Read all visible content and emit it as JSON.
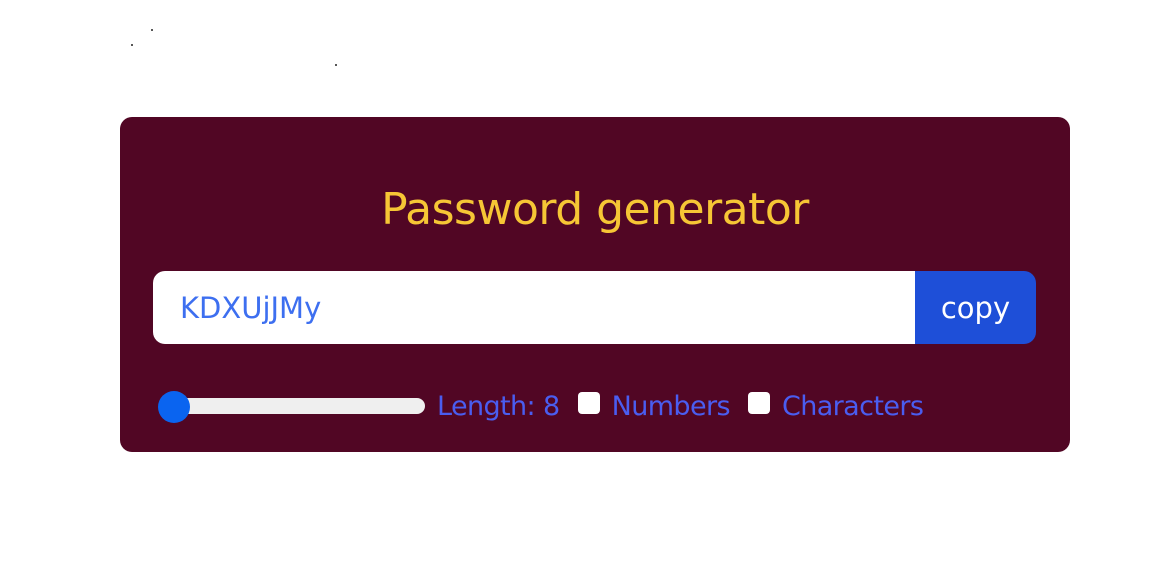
{
  "app": {
    "title": "Password generator"
  },
  "password": {
    "value": "KDXUjJMy",
    "copy_label": "copy"
  },
  "controls": {
    "length_label": "Length: 8",
    "length_value": 8,
    "numbers_label": "Numbers",
    "numbers_checked": false,
    "characters_label": "Characters",
    "characters_checked": false
  },
  "colors": {
    "card_background": "#510624",
    "title": "#f6c635",
    "accent": "#1e4fd8",
    "label_text": "#4a5df0",
    "slider_thumb": "#0a64f0"
  },
  "icons": {
    "slider": "range-slider",
    "checkbox": "checkbox-unchecked"
  }
}
